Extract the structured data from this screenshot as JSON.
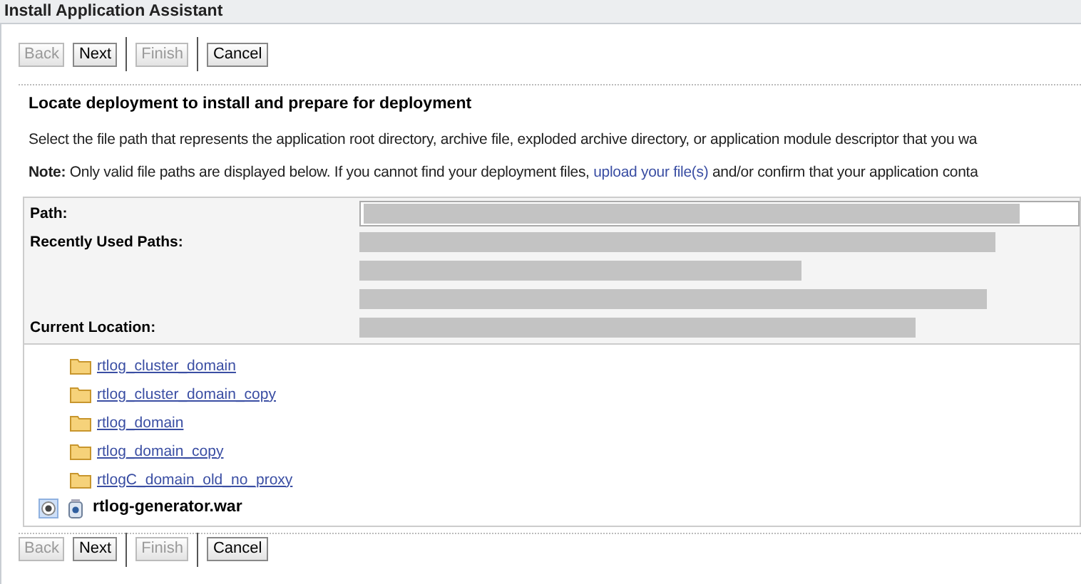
{
  "window": {
    "title": "Install Application Assistant"
  },
  "top_buttons": [
    {
      "label": "Back",
      "disabled": true,
      "separator_before": false
    },
    {
      "label": "Next",
      "disabled": false,
      "separator_before": false
    },
    {
      "label": "Finish",
      "disabled": true,
      "separator_before": true
    },
    {
      "label": "Cancel",
      "disabled": false,
      "separator_before": true
    }
  ],
  "heading": "Locate deployment to install and prepare for deployment",
  "description": "Select the file path that represents the application root directory, archive file, exploded archive directory, or application module descriptor that you wa",
  "note": "**Note:** Only valid file paths are displayed below. If you cannot find your deployment files, ",
  "note_link": "upload your file(s)",
  "note_tail": " and/or confirm that your application conta",
  "form": {
    "path_label": "Path:",
    "recent_label": "Recently Used Paths:",
    "current_label": "Current Location:"
  },
  "tree": [
    {
      "kind": "folder",
      "label": "rtlog_cluster_domain"
    },
    {
      "kind": "folder",
      "label": "rtlog_cluster_domain_copy"
    },
    {
      "kind": "folder",
      "label": "rtlog_domain"
    },
    {
      "kind": "folder",
      "label": "rtlog_domain_copy"
    },
    {
      "kind": "folder",
      "label": "rtlogC_domain_old_no_proxy"
    },
    {
      "kind": "archive",
      "label": "rtlog-generator.war",
      "selected": true
    }
  ],
  "bottom_buttons": [
    {
      "label": "Back",
      "disabled": true,
      "separator_before": false
    },
    {
      "label": "Next",
      "disabled": false,
      "separator_before": false
    },
    {
      "label": "Finish",
      "disabled": true,
      "separator_before": true
    },
    {
      "label": "Cancel",
      "disabled": false,
      "separator_before": true
    }
  ]
}
